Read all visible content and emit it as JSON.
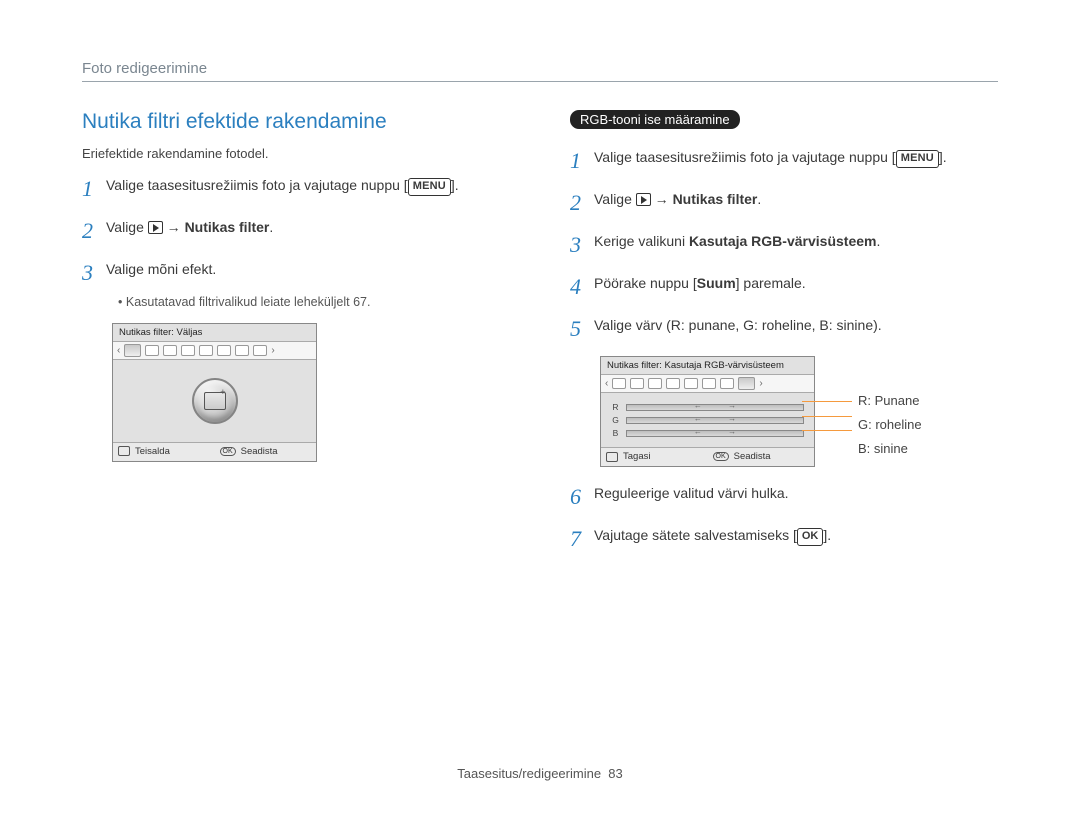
{
  "breadcrumb": "Foto redigeerimine",
  "left": {
    "heading": "Nutika filtri efektide rakendamine",
    "subtext": "Eriefektide rakendamine fotodel.",
    "steps": {
      "s1_a": "Valige taasesitusrežiimis foto ja vajutage nuppu [",
      "s1_b": "].",
      "s2_a": "Valige ",
      "s2_b": " → ",
      "s2_c": "Nutikas filter",
      "s2_d": ".",
      "s3": "Valige mõni efekt."
    },
    "bullet": "Kasutatavad filtrivalikud leiate leheküljelt 67.",
    "menu_label": "MENU",
    "lcd": {
      "title": "Nutikas filter:  Väljas",
      "foot_left": "Teisalda",
      "foot_right": "Seadista",
      "ok": "OK"
    }
  },
  "right": {
    "pill": "RGB-tooni ise määramine",
    "steps": {
      "s1_a": "Valige taasesitusrežiimis foto ja vajutage nuppu [",
      "s1_b": "].",
      "s2_a": "Valige ",
      "s2_b": " → ",
      "s2_c": "Nutikas filter",
      "s2_d": ".",
      "s3_a": "Kerige valikuni ",
      "s3_b": "Kasutaja RGB-värvisüsteem",
      "s3_c": ".",
      "s4_a": "Pöörake nuppu [",
      "s4_b": "Suum",
      "s4_c": "] paremale.",
      "s5": "Valige värv (R: punane, G: roheline, B: sinine).",
      "s6": "Reguleerige valitud värvi hulka.",
      "s7_a": "Vajutage sätete salvestamiseks [",
      "s7_b": "]."
    },
    "menu_label": "MENU",
    "ok_label": "OK",
    "lcd": {
      "title": "Nutikas filter: Kasutaja RGB-värvisüsteem",
      "r": "R",
      "g": "G",
      "b": "B",
      "foot_left": "Tagasi",
      "foot_right": "Seadista",
      "ok": "OK"
    },
    "legend": {
      "r": "R: Punane",
      "g": "G: roheline",
      "b": "B: sinine"
    }
  },
  "footer": {
    "section": "Taasesitus/redigeerimine",
    "page": "83"
  }
}
